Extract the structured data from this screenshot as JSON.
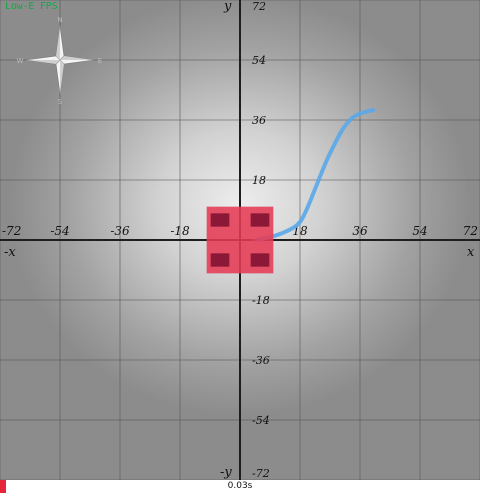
{
  "hud": {
    "fps_label": "Low-E FPS"
  },
  "compass": {
    "north": "N",
    "east": "E",
    "south": "S",
    "west": "W"
  },
  "axes": {
    "x_label": "x",
    "neg_x_label": "-x",
    "y_label": "y",
    "neg_y_label": "-y",
    "x_ticks": [
      "-72",
      "-54",
      "-36",
      "-18",
      "18",
      "36",
      "54",
      "72"
    ],
    "y_ticks": [
      "72",
      "54",
      "36",
      "18",
      "-18",
      "-36",
      "-54",
      "-72"
    ],
    "range": [
      -72,
      72
    ]
  },
  "path_trace": {
    "color": "#5aa7e8",
    "x": [
      5,
      10,
      15,
      18,
      20,
      22,
      24,
      26,
      28,
      30,
      32,
      34,
      36,
      38,
      40
    ],
    "y": [
      0,
      1,
      3,
      5,
      9,
      14,
      19,
      24,
      28,
      32,
      35,
      37,
      38,
      38.5,
      39
    ]
  },
  "robot": {
    "color": "#e63b55",
    "wheel_color": "#8c1838",
    "x_range": [
      -10,
      10
    ],
    "y_range": [
      -10,
      10
    ]
  },
  "playback": {
    "time_label": "0.03s",
    "progress": 0.012,
    "color": "#e4253a"
  }
}
